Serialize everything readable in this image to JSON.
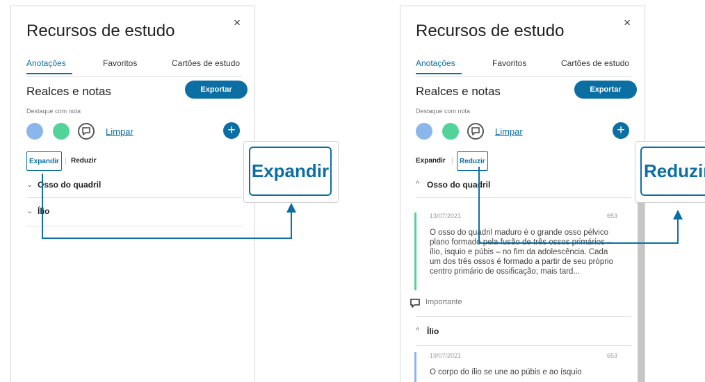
{
  "colors": {
    "accent": "#0b6fa4",
    "blue_swatch": "#8ab6ec",
    "green_swatch": "#52d39a"
  },
  "panels": [
    {
      "title": "Recursos de estudo",
      "close": "×",
      "tabs": [
        "Anotações",
        "Favoritos",
        "Cartões de estudo"
      ],
      "section_title": "Realces e notas",
      "export_label": "Exportar",
      "highlight_label": "Destaque com nota",
      "clear_label": "Limpar",
      "add_label": "+",
      "expand_label": "Expandir",
      "collapse_label": "Reduzir",
      "separator": "|",
      "accordion": [
        {
          "label": "Osso do quadril",
          "state": "collapsed",
          "chevron": "⌄"
        },
        {
          "label": "Ílio",
          "state": "collapsed",
          "chevron": "⌄"
        }
      ]
    },
    {
      "title": "Recursos de estudo",
      "close": "×",
      "tabs": [
        "Anotações",
        "Favoritos",
        "Cartões de estudo"
      ],
      "section_title": "Realces e notas",
      "export_label": "Exportar",
      "highlight_label": "Destaque com nota",
      "clear_label": "Limpar",
      "add_label": "+",
      "expand_label": "Expandir",
      "collapse_label": "Reduzir",
      "separator": "|",
      "accordion": [
        {
          "label": "Osso do quadril",
          "state": "expanded",
          "chevron": "^",
          "note": {
            "date": "13/07/2021",
            "page": "653",
            "text": "O osso do quadril maduro é o grande osso pélvico plano formado pela fusão de três ossos primários – ílio, ísquio e púbis – no fim da adolescência. Cada um dos três ossos é formado a partir de seu próprio centro primário de ossificação; mais tard...",
            "tag": "Importante"
          }
        },
        {
          "label": "Ílio",
          "state": "expanded",
          "chevron": "^",
          "note": {
            "date": "19/07/2021",
            "page": "653",
            "text": "O corpo do ílio se une ao púbis e ao ísquio"
          }
        }
      ]
    }
  ],
  "callouts": {
    "left": "Expandir",
    "right": "Reduzir"
  }
}
